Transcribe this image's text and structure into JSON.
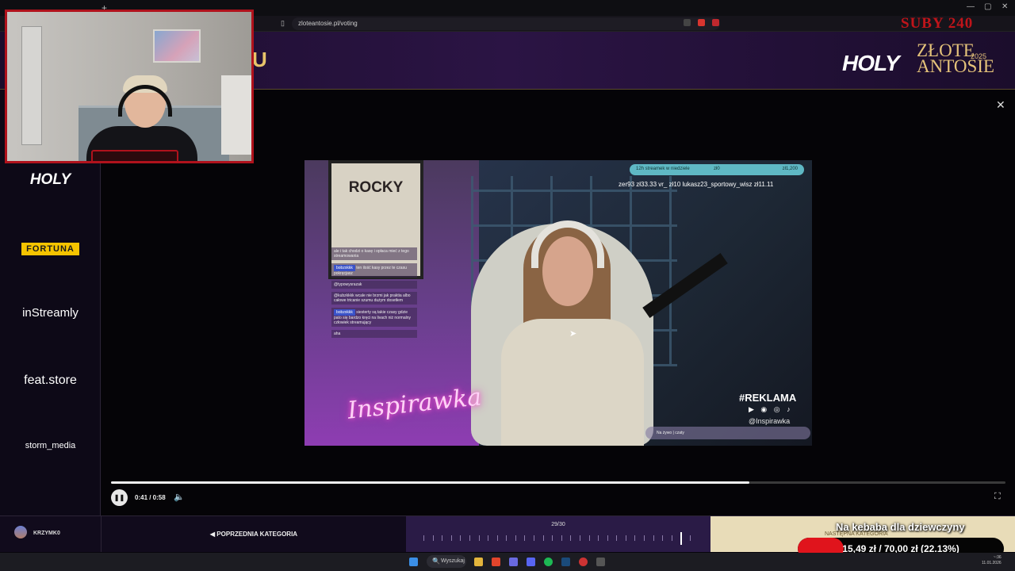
{
  "browser": {
    "url": "zloteantosie.pl/voting",
    "new_tab_icon": "+",
    "window_controls": [
      "—",
      "▢",
      "✕"
    ]
  },
  "overlay": {
    "sub_text": "SUBY 240"
  },
  "header": {
    "title_fragment": "U",
    "logo_holy": "HOLY",
    "logo_line1": "ZŁOTE",
    "logo_line2": "ANTOSIE",
    "logo_year": "2025"
  },
  "sidebar": {
    "sponsors": [
      "HOLY",
      "FORTUNA",
      "inStreamly",
      "feat.store",
      "storm_media"
    ]
  },
  "video": {
    "poster_title": "ROCKY",
    "neon_text": "Inspirawka",
    "top_bar_left": "12h streamek w niedziele",
    "top_bar_mid": "zł0",
    "top_bar_right": "zł1,200",
    "ticker": "zer93 zł33.33   vr_ zł10   lukasz23_sportowy_wisz zł11.11",
    "reklama": "#REKLAMA",
    "handle": "@Inspirawka",
    "chat_input": "Na żywo | czaty",
    "chat": [
      {
        "name": "",
        "text": "ale i tak chodzi o kasę i opłaca mieć z tego streamowania"
      },
      {
        "name": "bobzxkkk",
        "text": "ten ilość kasy przez te czasu pokręcjasz"
      },
      {
        "name": "",
        "text": "@typowysrazak"
      },
      {
        "name": "",
        "text": "@kubzkkkk wcale nie brzmi jak praktia albo całowe tricanie szumu dużym dosetłem"
      },
      {
        "name": "bobzxkkk",
        "text": "siesterty są takie czasy gdzie pato się bardzo kręci na livach niż normalny człowiek streamujący"
      },
      {
        "name": "",
        "text": "aha"
      }
    ]
  },
  "player": {
    "time": "0:41 / 0:58",
    "progress": 0.714
  },
  "bottom": {
    "username": "KRZYMK0",
    "prev_category": "POPRZEDNIA KATEGORIA",
    "counter": "29/30",
    "current": 29,
    "total": 30,
    "next_category": "NASTĘPNA KATEGORIA",
    "donation_title": "Na kebaba dla dziewczyny",
    "donation_text": "15,49 zł / 70,00 zł (22.13%)",
    "donation_fraction": 0.2213
  },
  "taskbar": {
    "search_label": "Wyszukaj",
    "search_icon": "🔍",
    "clock_time": "~:36",
    "clock_date": "11.01.2026"
  },
  "colors": {
    "accent_gold": "#e5c37a",
    "overlay_red": "#b0121c",
    "donation_red": "#e0141c"
  }
}
